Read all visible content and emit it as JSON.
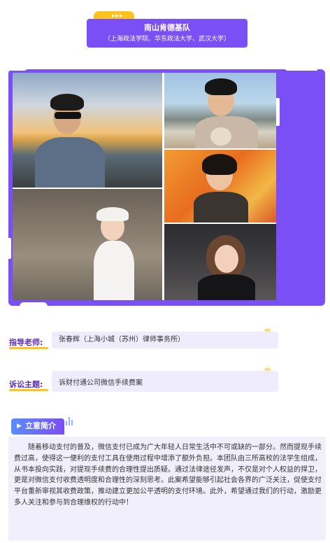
{
  "header": {
    "team_name": "南山肯德基队",
    "schools": "（上海政法学院、华东政法大学、武汉大学）",
    "tag_arrows": "▸▸▸"
  },
  "photos": {
    "alt_1": "团队成员照片1",
    "alt_2": "团队成员照片2",
    "alt_3": "团队成员照片3",
    "alt_4": "团队成员照片4",
    "alt_5": "团队成员照片5"
  },
  "advisor": {
    "label": "指导老师:",
    "value": "张春辉（上海小城（苏州）律师事务所）"
  },
  "topic": {
    "label": "诉讼主题:",
    "value": "诉财付通公司微信手续费案"
  },
  "chevrons": "‹‹‹",
  "intro": {
    "title": "立意简介",
    "arrow": "▶",
    "text": "随着移动支付的普及，微信支付已成为广大年轻人日常生活中不可或缺的一部分。然而提现手续费过高，使得这一便利的支付工具在使用过程中增添了额外负担。本团队由三所高校的法学生组成，从书本投向实践，对提现手续费的合理性提出质疑。通过法律途径发声，不仅是对个人权益的捍卫，更是对微信支付收费透明度和合理性的深刻思考。此案希望能够引起社会各界的广泛关注，促使支付平台重新审视其收费政策，推动建立更加公平透明的支付环境。此外，希望通过我们的行动，激励更多人关注和参与到合理维权的行动中！"
  },
  "colors": {
    "accent": "#7a4ff5",
    "highlight": "#ffc21a",
    "label": "#5b2bb8",
    "panel": "#efedfd"
  }
}
